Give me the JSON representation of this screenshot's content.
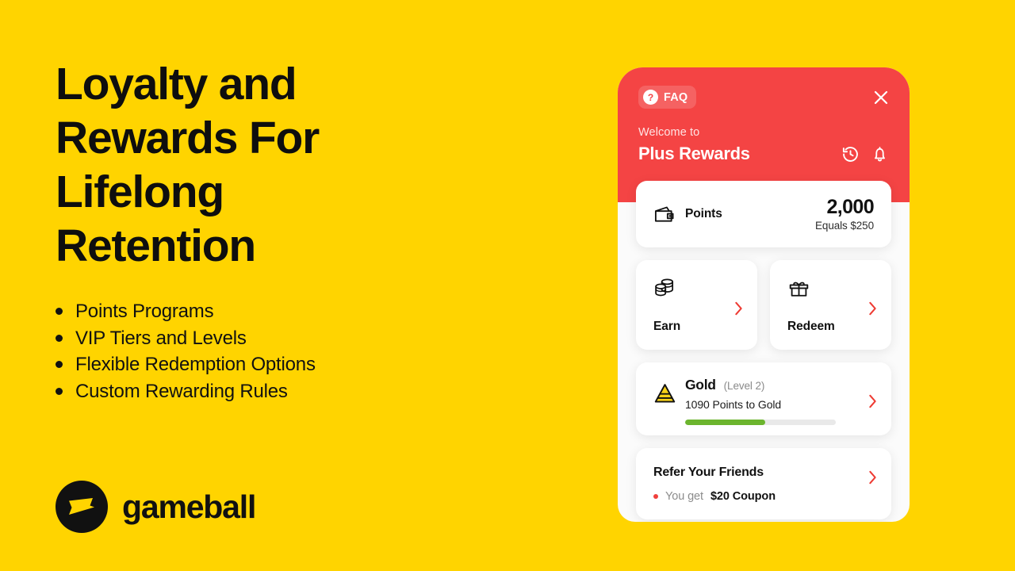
{
  "theme": {
    "background": "#FFD400",
    "accent_red": "#F44444",
    "chevron_red": "#EE3B33",
    "progress_green": "#6CB52E",
    "gold": "#F7D117",
    "text_dark": "#111111"
  },
  "left": {
    "headline": "Loyalty and Rewards For Lifelong Retention",
    "features": [
      {
        "label": "Points Programs"
      },
      {
        "label": "VIP Tiers and Levels"
      },
      {
        "label": "Flexible Redemption Options"
      },
      {
        "label": "Custom Rewarding Rules"
      }
    ],
    "logo": {
      "wordmark": "gameball",
      "mark_icon": "gameball-flag-icon"
    }
  },
  "phone": {
    "header": {
      "faq_label": "FAQ",
      "faq_icon": "question-mark-icon",
      "close_icon": "close-icon",
      "welcome_text": "Welcome to",
      "program_name": "Plus Rewards",
      "history_icon": "history-icon",
      "notification_icon": "bell-icon"
    },
    "points_card": {
      "icon": "wallet-icon",
      "label": "Points",
      "value": "2,000",
      "equals": "Equals $250"
    },
    "actions": [
      {
        "label": "Earn",
        "icon": "coins-icon",
        "chevron": "chevron-right-icon"
      },
      {
        "label": "Redeem",
        "icon": "gift-icon",
        "chevron": "chevron-right-icon"
      }
    ],
    "tier_card": {
      "icon": "gold-tier-pyramid-icon",
      "name": "Gold",
      "level": "(Level 2)",
      "progress_text": "1090 Points to Gold",
      "progress_percent": 53,
      "chevron": "chevron-right-icon"
    },
    "referral_card": {
      "title": "Refer Your Friends",
      "reward_prefix": "You get",
      "reward_value": "$20 Coupon",
      "chevron": "chevron-right-icon"
    }
  }
}
